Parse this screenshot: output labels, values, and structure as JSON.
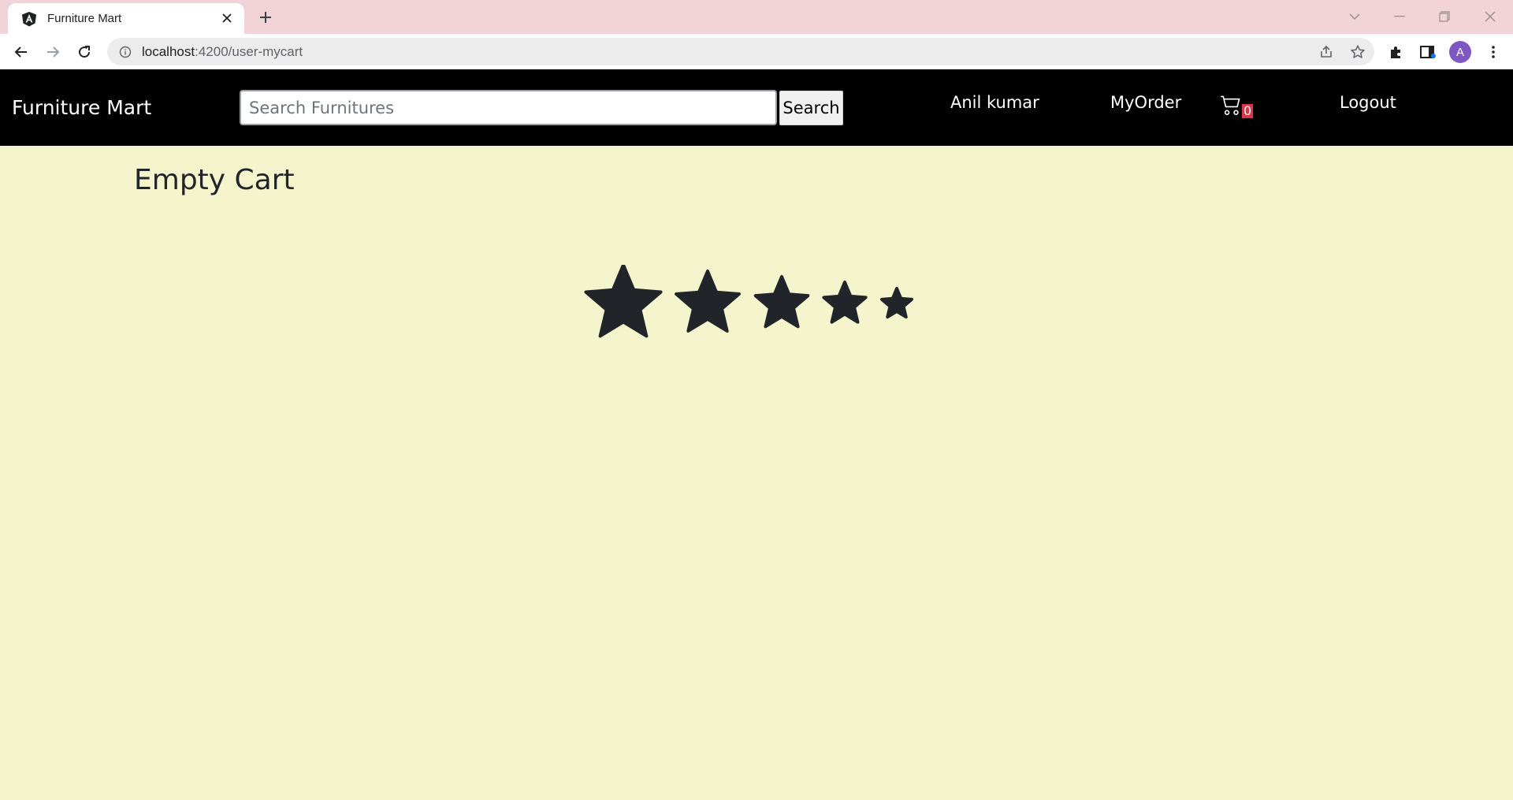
{
  "browser": {
    "tab_title": "Furniture Mart",
    "url_host": "localhost",
    "url_path": ":4200/user-mycart",
    "profile_initial": "A"
  },
  "navbar": {
    "brand": "Furniture Mart",
    "search_placeholder": "Search Furnitures",
    "search_button": "Search",
    "user_name": "Anil kumar",
    "my_order": "MyOrder",
    "cart_count": "0",
    "logout": "Logout"
  },
  "content": {
    "title": "Empty Cart"
  },
  "rating": {
    "stars": 5,
    "filled": 5,
    "color": "#212529"
  },
  "colors": {
    "page_background": "#f5f5cd",
    "navbar_background": "#000000",
    "tabstrip_background": "#f2d3d7",
    "badge": "#dc3545"
  }
}
